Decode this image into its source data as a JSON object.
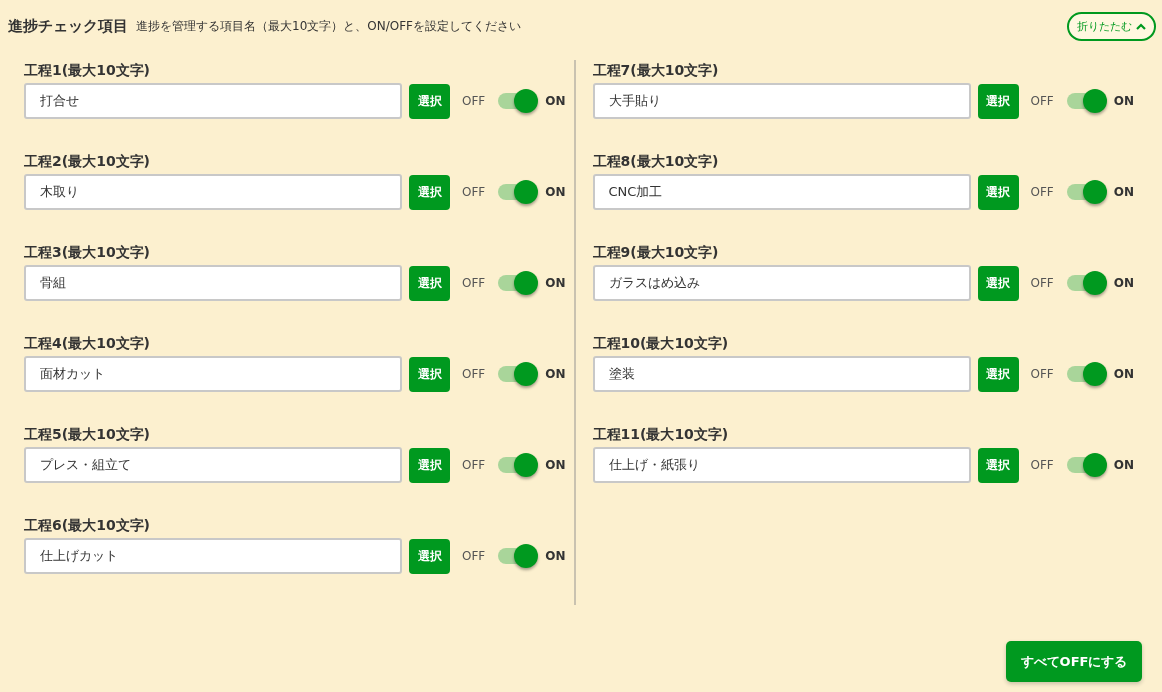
{
  "header": {
    "title": "進捗チェック項目",
    "description": "進捗を管理する項目名（最大10文字）と、ON/OFFを設定してください",
    "collapse_button": "折りたたむ"
  },
  "columns": [
    {
      "items": [
        {
          "label": "工程1(最大10文字)",
          "value": "打合せ",
          "button": "選択",
          "off_text": "OFF",
          "on_text": "ON",
          "on": true
        },
        {
          "label": "工程2(最大10文字)",
          "value": "木取り",
          "button": "選択",
          "off_text": "OFF",
          "on_text": "ON",
          "on": true
        },
        {
          "label": "工程3(最大10文字)",
          "value": "骨組",
          "button": "選択",
          "off_text": "OFF",
          "on_text": "ON",
          "on": true
        },
        {
          "label": "工程4(最大10文字)",
          "value": "面材カット",
          "button": "選択",
          "off_text": "OFF",
          "on_text": "ON",
          "on": true
        },
        {
          "label": "工程5(最大10文字)",
          "value": "プレス・組立て",
          "button": "選択",
          "off_text": "OFF",
          "on_text": "ON",
          "on": true
        },
        {
          "label": "工程6(最大10文字)",
          "value": "仕上げカット",
          "button": "選択",
          "off_text": "OFF",
          "on_text": "ON",
          "on": true
        }
      ]
    },
    {
      "items": [
        {
          "label": "工程7(最大10文字)",
          "value": "大手貼り",
          "button": "選択",
          "off_text": "OFF",
          "on_text": "ON",
          "on": true
        },
        {
          "label": "工程8(最大10文字)",
          "value": "CNC加工",
          "button": "選択",
          "off_text": "OFF",
          "on_text": "ON",
          "on": true
        },
        {
          "label": "工程9(最大10文字)",
          "value": "ガラスはめ込み",
          "button": "選択",
          "off_text": "OFF",
          "on_text": "ON",
          "on": true
        },
        {
          "label": "工程10(最大10文字)",
          "value": "塗装",
          "button": "選択",
          "off_text": "OFF",
          "on_text": "ON",
          "on": true
        },
        {
          "label": "工程11(最大10文字)",
          "value": "仕上げ・紙張り",
          "button": "選択",
          "off_text": "OFF",
          "on_text": "ON",
          "on": true
        }
      ]
    }
  ],
  "footer": {
    "all_off_button": "すべてOFFにする"
  }
}
